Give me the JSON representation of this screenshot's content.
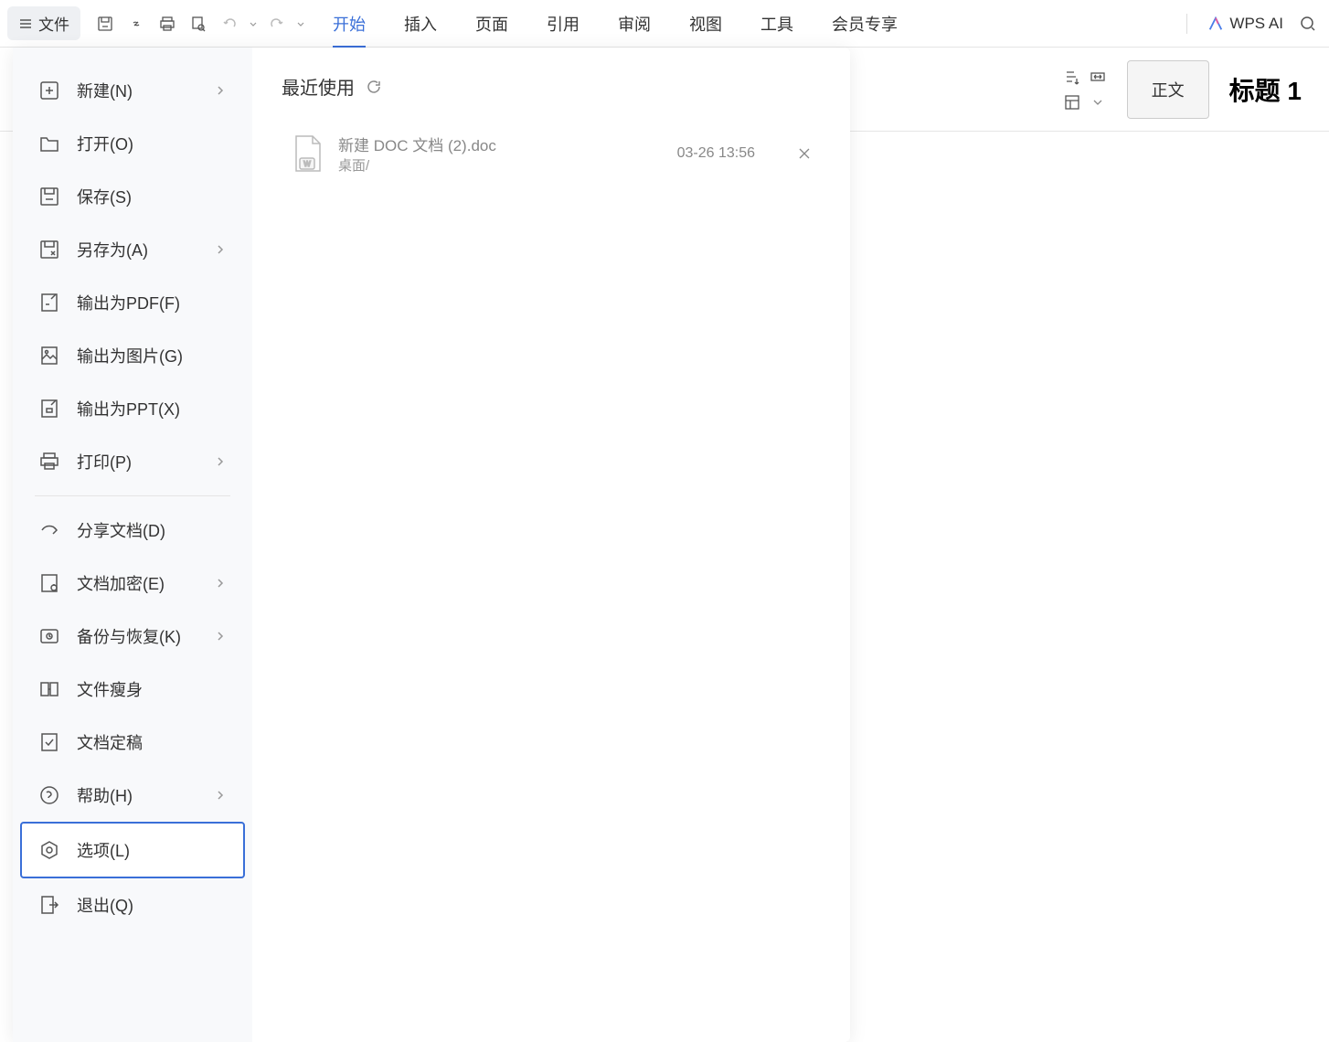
{
  "toolbar": {
    "file_label": "文件",
    "tabs": [
      "开始",
      "插入",
      "页面",
      "引用",
      "审阅",
      "视图",
      "工具",
      "会员专享"
    ],
    "active_tab": 0,
    "wps_ai": "WPS AI"
  },
  "ribbon": {
    "style_normal": "正文",
    "style_heading": "标题  1"
  },
  "file_menu": {
    "items": [
      {
        "label": "新建(N)",
        "icon": "new",
        "chevron": true
      },
      {
        "label": "打开(O)",
        "icon": "open",
        "chevron": false
      },
      {
        "label": "保存(S)",
        "icon": "save",
        "chevron": false
      },
      {
        "label": "另存为(A)",
        "icon": "saveas",
        "chevron": true
      },
      {
        "label": "输出为PDF(F)",
        "icon": "pdf",
        "chevron": false
      },
      {
        "label": "输出为图片(G)",
        "icon": "image",
        "chevron": false
      },
      {
        "label": "输出为PPT(X)",
        "icon": "ppt",
        "chevron": false
      },
      {
        "label": "打印(P)",
        "icon": "print",
        "chevron": true,
        "divider_after": true
      },
      {
        "label": "分享文档(D)",
        "icon": "share",
        "chevron": false
      },
      {
        "label": "文档加密(E)",
        "icon": "encrypt",
        "chevron": true
      },
      {
        "label": "备份与恢复(K)",
        "icon": "backup",
        "chevron": true
      },
      {
        "label": "文件瘦身",
        "icon": "slim",
        "chevron": false
      },
      {
        "label": "文档定稿",
        "icon": "final",
        "chevron": false
      },
      {
        "label": "帮助(H)",
        "icon": "help",
        "chevron": true
      },
      {
        "label": "选项(L)",
        "icon": "options",
        "chevron": false,
        "selected": true
      },
      {
        "label": "退出(Q)",
        "icon": "exit",
        "chevron": false
      }
    ]
  },
  "recent": {
    "title": "最近使用",
    "items": [
      {
        "name": "新建 DOC 文档 (2).doc",
        "path": "桌面/",
        "time": "03-26 13:56"
      }
    ]
  }
}
